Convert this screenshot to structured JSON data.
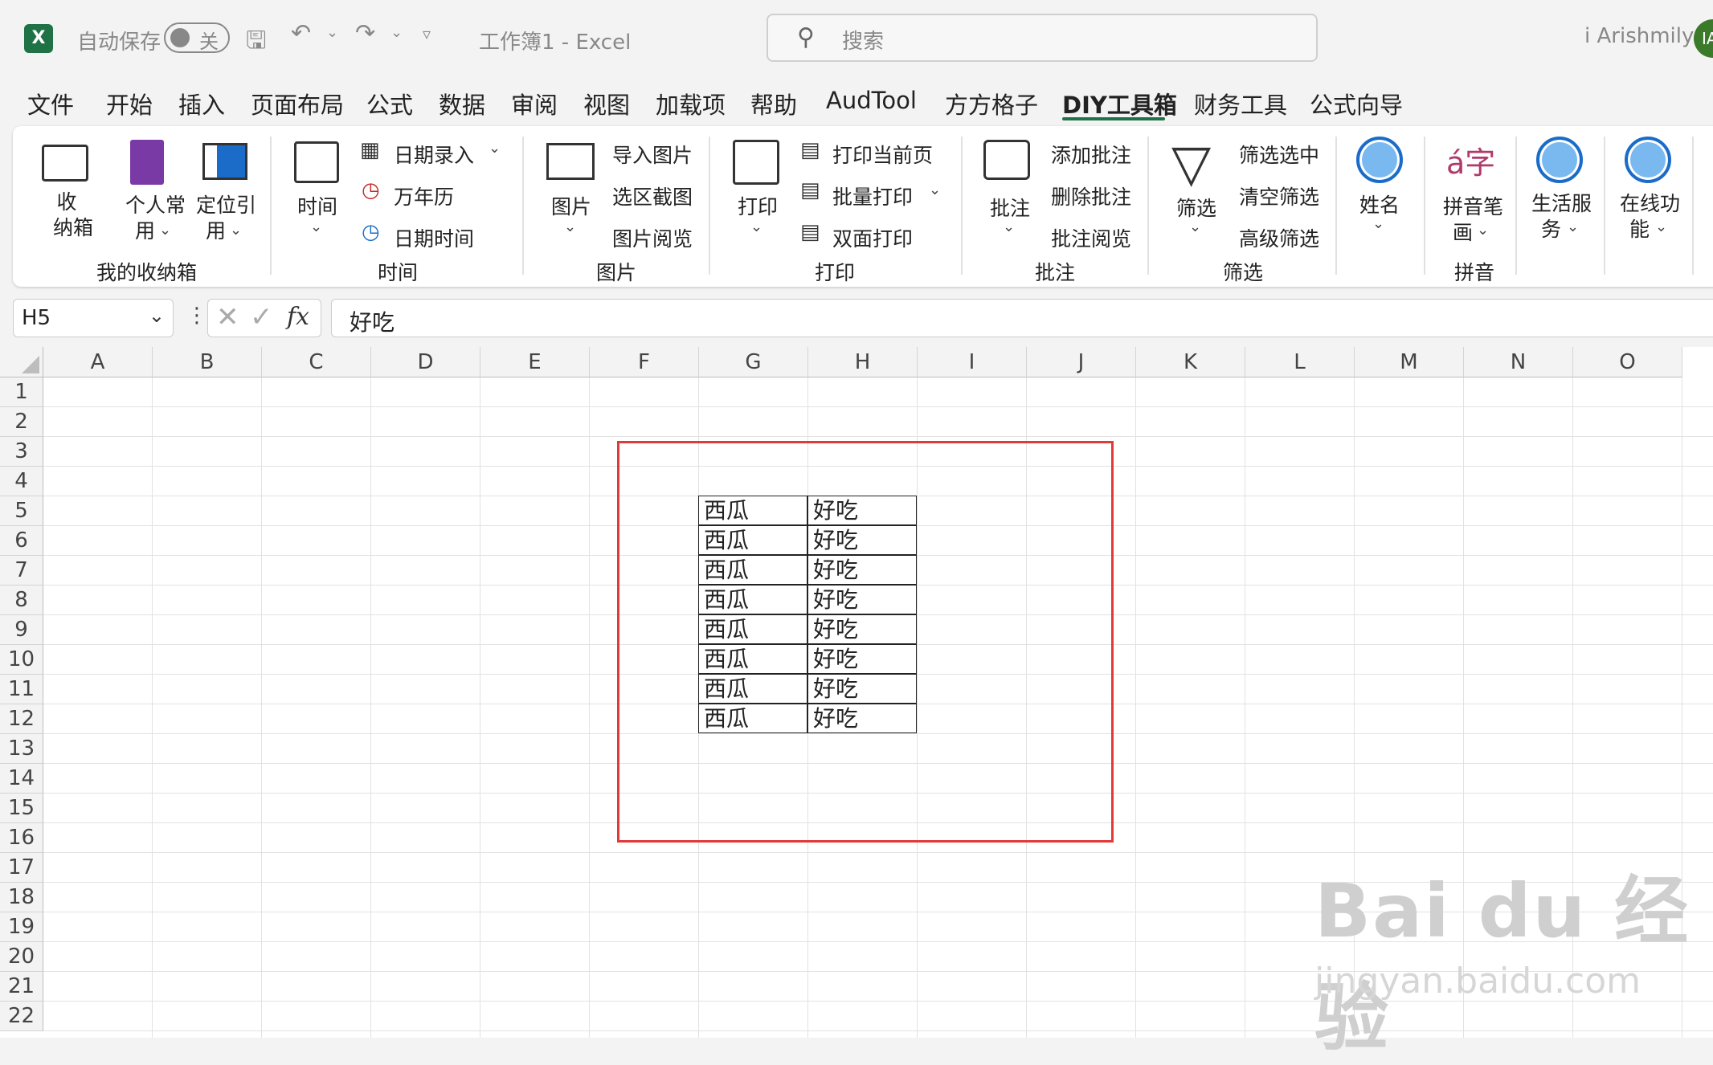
{
  "titlebar": {
    "app_icon": "X",
    "autosave_label": "自动保存",
    "autosave_state": "关",
    "doc_title": "工作簿1  -  Excel",
    "search_placeholder": "搜索",
    "user_name": "i Arishmily",
    "avatar_initials": "IA",
    "icons": [
      "save-icon",
      "undo-icon",
      "redo-icon",
      "customize-icon",
      "search-icon"
    ]
  },
  "tabs": [
    "文件",
    "开始",
    "插入",
    "页面布局",
    "公式",
    "数据",
    "审阅",
    "视图",
    "加载项",
    "帮助",
    "AudTool",
    "方方格子",
    "DIY工具箱",
    "财务工具",
    "公式向导"
  ],
  "active_tab": "DIY工具箱",
  "ribbon": {
    "g1": {
      "name": "我的收纳箱",
      "b1": "收\n纳箱",
      "b2_1": "个人常",
      "b2_2": "用",
      "b3_1": "定位引",
      "b3_2": "用"
    },
    "g2": {
      "name": "时间",
      "big": "时间",
      "s1": "日期录入",
      "s2": "万年历",
      "s3": "日期时间"
    },
    "g3": {
      "name": "图片",
      "big": "图片",
      "s1": "导入图片",
      "s2": "选区截图",
      "s3": "图片阅览"
    },
    "g4": {
      "name": "打印",
      "big": "打印",
      "s1": "打印当前页",
      "s2": "批量打印",
      "s3": "双面打印"
    },
    "g5": {
      "name": "批注",
      "big": "批注",
      "s1": "添加批注",
      "s2": "删除批注",
      "s3": "批注阅览"
    },
    "g6": {
      "name": "筛选",
      "big": "筛选",
      "s1": "筛选选中",
      "s2": "清空筛选",
      "s3": "高级筛选"
    },
    "g7": {
      "big": "姓名"
    },
    "g8": {
      "name": "拼音",
      "big1": "拼音笔",
      "big2": "画",
      "icon_text": "á字"
    },
    "g9": {
      "big1": "生活服",
      "big2": "务"
    },
    "g10": {
      "big1": "在线功",
      "big2": "能"
    }
  },
  "formula_bar": {
    "name_box": "H5",
    "value": "好吃",
    "fx": "fx"
  },
  "columns": [
    "A",
    "B",
    "C",
    "D",
    "E",
    "F",
    "G",
    "H",
    "I",
    "J",
    "K",
    "L",
    "M",
    "N",
    "O"
  ],
  "rows": [
    "1",
    "2",
    "3",
    "4",
    "5",
    "6",
    "7",
    "8",
    "9",
    "10",
    "11",
    "12",
    "13",
    "14",
    "15",
    "16",
    "17",
    "18",
    "19",
    "20",
    "21",
    "22"
  ],
  "table": [
    [
      "西瓜",
      "好吃"
    ],
    [
      "西瓜",
      "好吃"
    ],
    [
      "西瓜",
      "好吃"
    ],
    [
      "西瓜",
      "好吃"
    ],
    [
      "西瓜",
      "好吃"
    ],
    [
      "西瓜",
      "好吃"
    ],
    [
      "西瓜",
      "好吃"
    ],
    [
      "西瓜",
      "好吃"
    ]
  ],
  "watermark": {
    "main": "Bai du 经验",
    "sub": "jingyan.baidu.com"
  },
  "colors": {
    "accent": "#1f7246",
    "highlight": "#e03a3a",
    "circle_icon": "#1a6cc8"
  }
}
